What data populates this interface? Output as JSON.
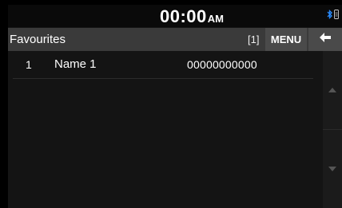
{
  "status_bar": {
    "time": "00:00",
    "ampm": "AM",
    "icons": [
      "bluetooth-icon",
      "phone-icon"
    ],
    "bluetooth_color": "#2a8cff"
  },
  "header": {
    "title": "Favourites",
    "count": "[1]",
    "menu_label": "MENU",
    "back_icon": "back-arrow-icon"
  },
  "list": {
    "items": [
      {
        "index": "1",
        "name": "Name 1",
        "number": "00000000000"
      }
    ]
  },
  "scrollbar": {
    "up_icon": "scroll-up-icon",
    "down_icon": "scroll-down-icon"
  }
}
